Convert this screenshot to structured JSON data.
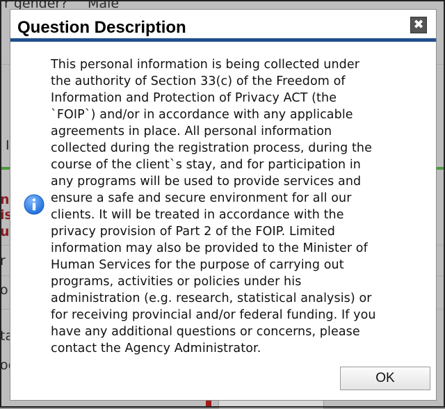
{
  "background": {
    "field_label": "r gender?",
    "field_value": "Male",
    "partial_letters": [
      "I",
      "n",
      "is",
      "u",
      "r",
      "o",
      "ta",
      "oo"
    ]
  },
  "dialog": {
    "title": "Question Description",
    "close_glyph": "✖",
    "icon": "info-icon",
    "message_lines": [
      "This personal information is being collected under",
      "the authority of Section 33(c) of the Freedom of",
      "Information and Protection of Privacy ACT (the",
      "`FOIP`) and/or in accordance with any applicable",
      "agreements in place. All personal information",
      "collected during the registration process, during the",
      "course of the client`s stay, and for participation in",
      "any programs will be used to provide services and",
      "ensure a safe and secure environment for all our",
      "clients. It will be treated in accordance with the",
      "privacy provision of Part 2 of the FOIP. Limited",
      "information may also be provided to the Minister of",
      "Human Services for the purpose of carrying out",
      "programs, activities or policies under his",
      "administration (e.g. research, statistical analysis) or",
      "for receiving provincial and/or federal funding. If you",
      "have any additional questions or concerns, please",
      "contact the Agency Administrator."
    ],
    "ok_label": "OK"
  },
  "colors": {
    "title_rule": "#1f4e8c",
    "info_icon": "#1e6fd9"
  }
}
